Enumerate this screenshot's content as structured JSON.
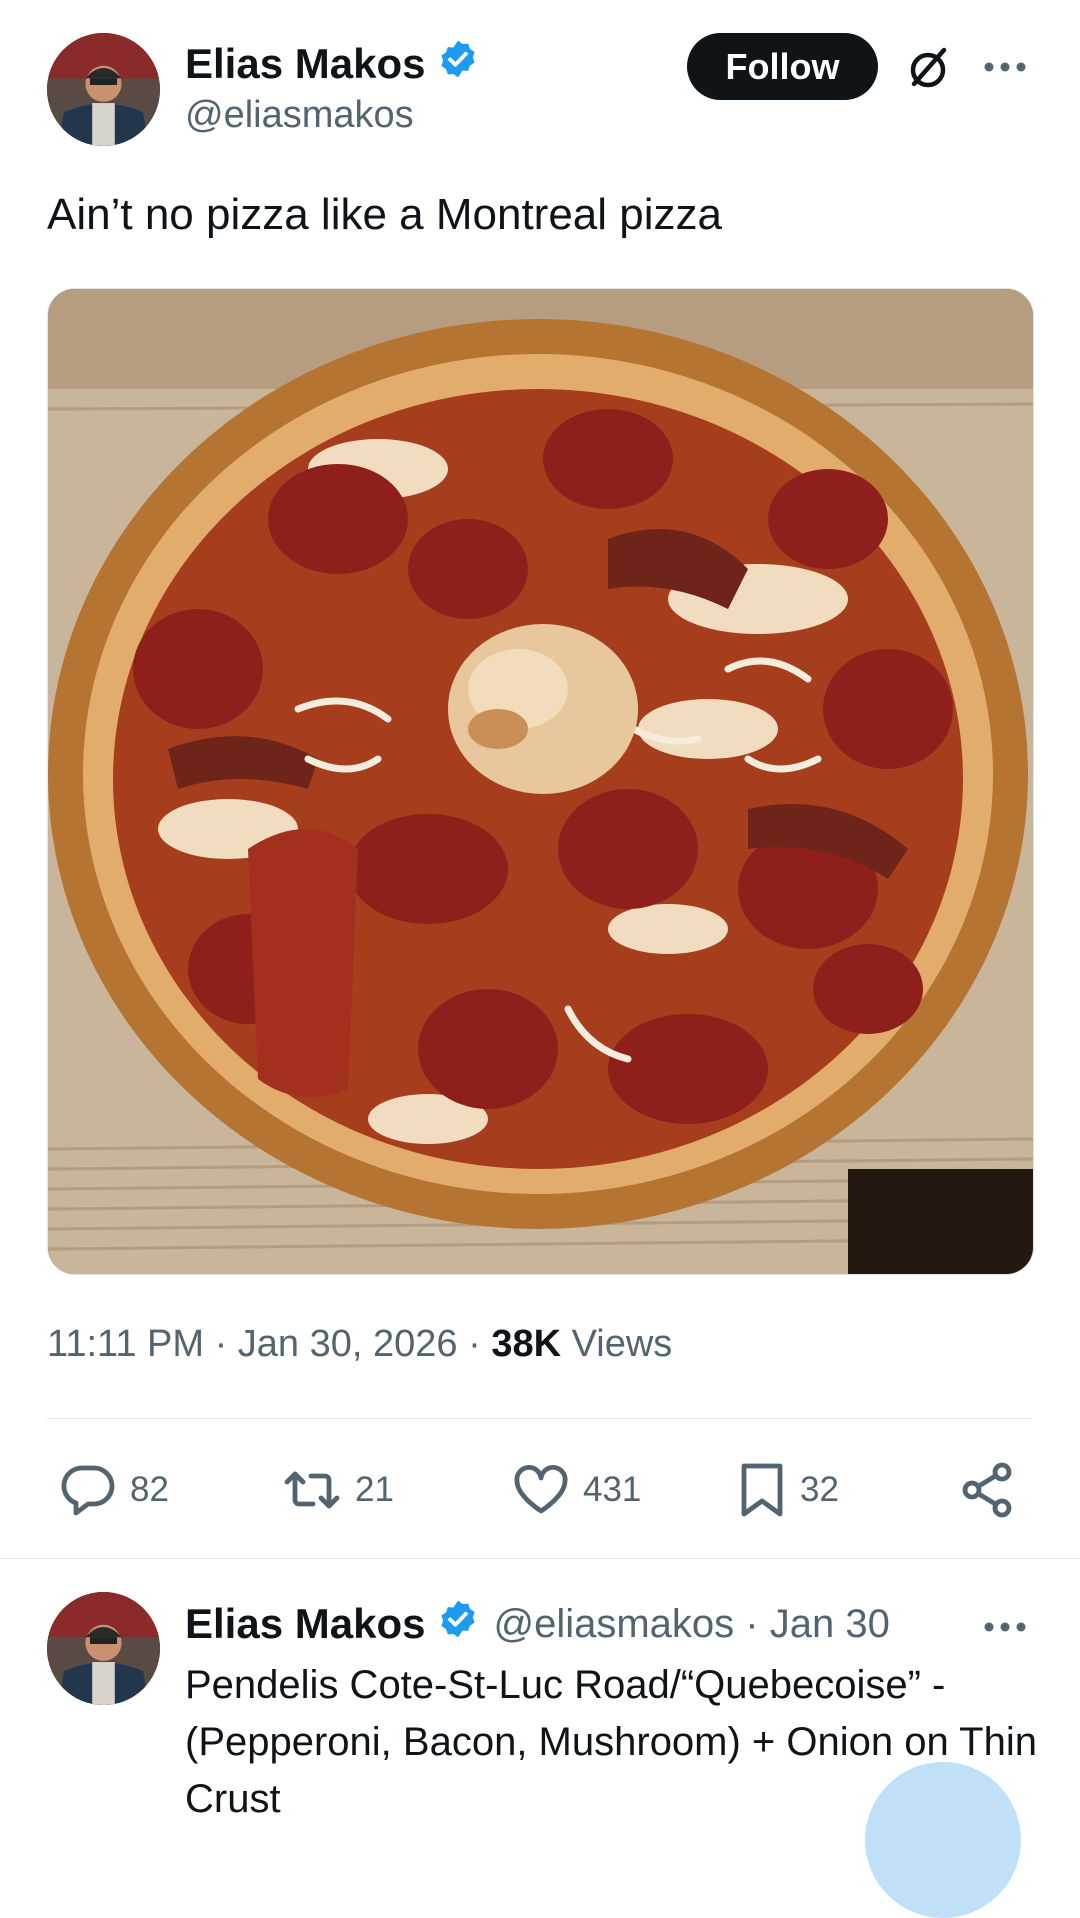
{
  "main_tweet": {
    "author_name": "Elias Makos",
    "handle": "@eliasmakos",
    "follow_label": "Follow",
    "text": "Ain’t no pizza like a Montreal pizza",
    "time": "11:11 PM",
    "date": "Jan 30, 2026",
    "views_count": "38K",
    "views_label": "Views"
  },
  "actions": {
    "replies": "82",
    "reposts": "21",
    "likes": "431",
    "bookmarks": "32"
  },
  "reply": {
    "author_name": "Elias Makos",
    "handle": "@eliasmakos",
    "date": "Jan 30",
    "text": "Pendelis Cote-St-Luc Road/“Quebecoise” - (Pepperoni, Bacon, Mushroom) + Onion on Thin Crust"
  },
  "colors": {
    "verified": "#1d9bf0",
    "text_primary": "#0f1419",
    "text_secondary": "#536471",
    "follow_bg": "#0f1419"
  },
  "icons": [
    "verified-badge-icon",
    "grok-icon",
    "more-icon",
    "reply-icon",
    "repost-icon",
    "like-icon",
    "bookmark-icon",
    "share-icon",
    "compose-icon"
  ]
}
